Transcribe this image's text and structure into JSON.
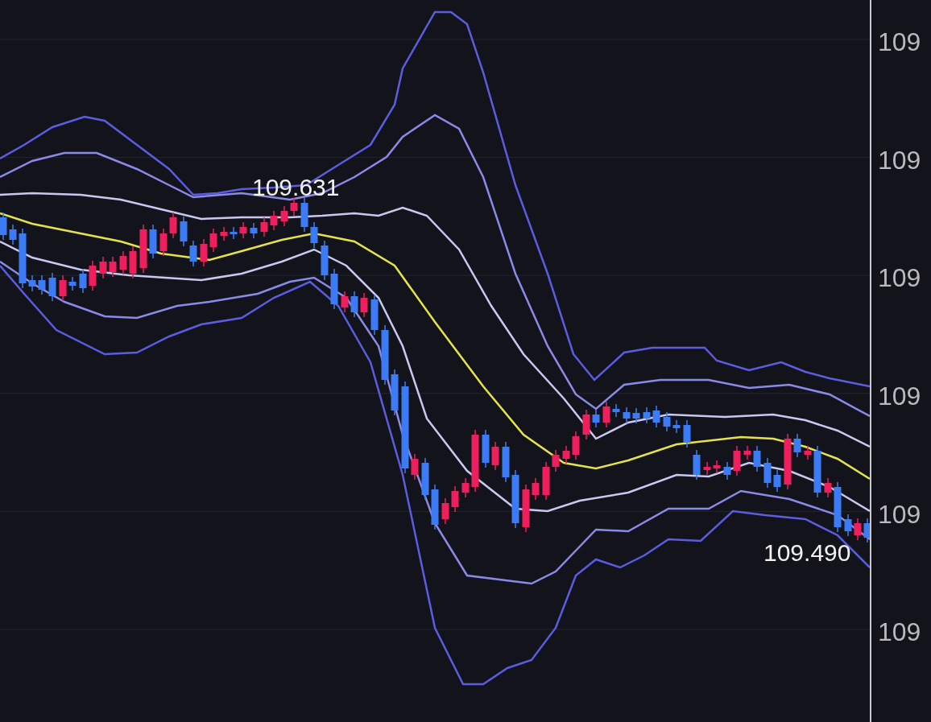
{
  "price_axis": {
    "ticks": [
      "109",
      "109",
      "109",
      "109",
      "109",
      "109"
    ]
  },
  "price_labels": [
    {
      "text": "109.631"
    },
    {
      "text": "109.490"
    }
  ]
}
